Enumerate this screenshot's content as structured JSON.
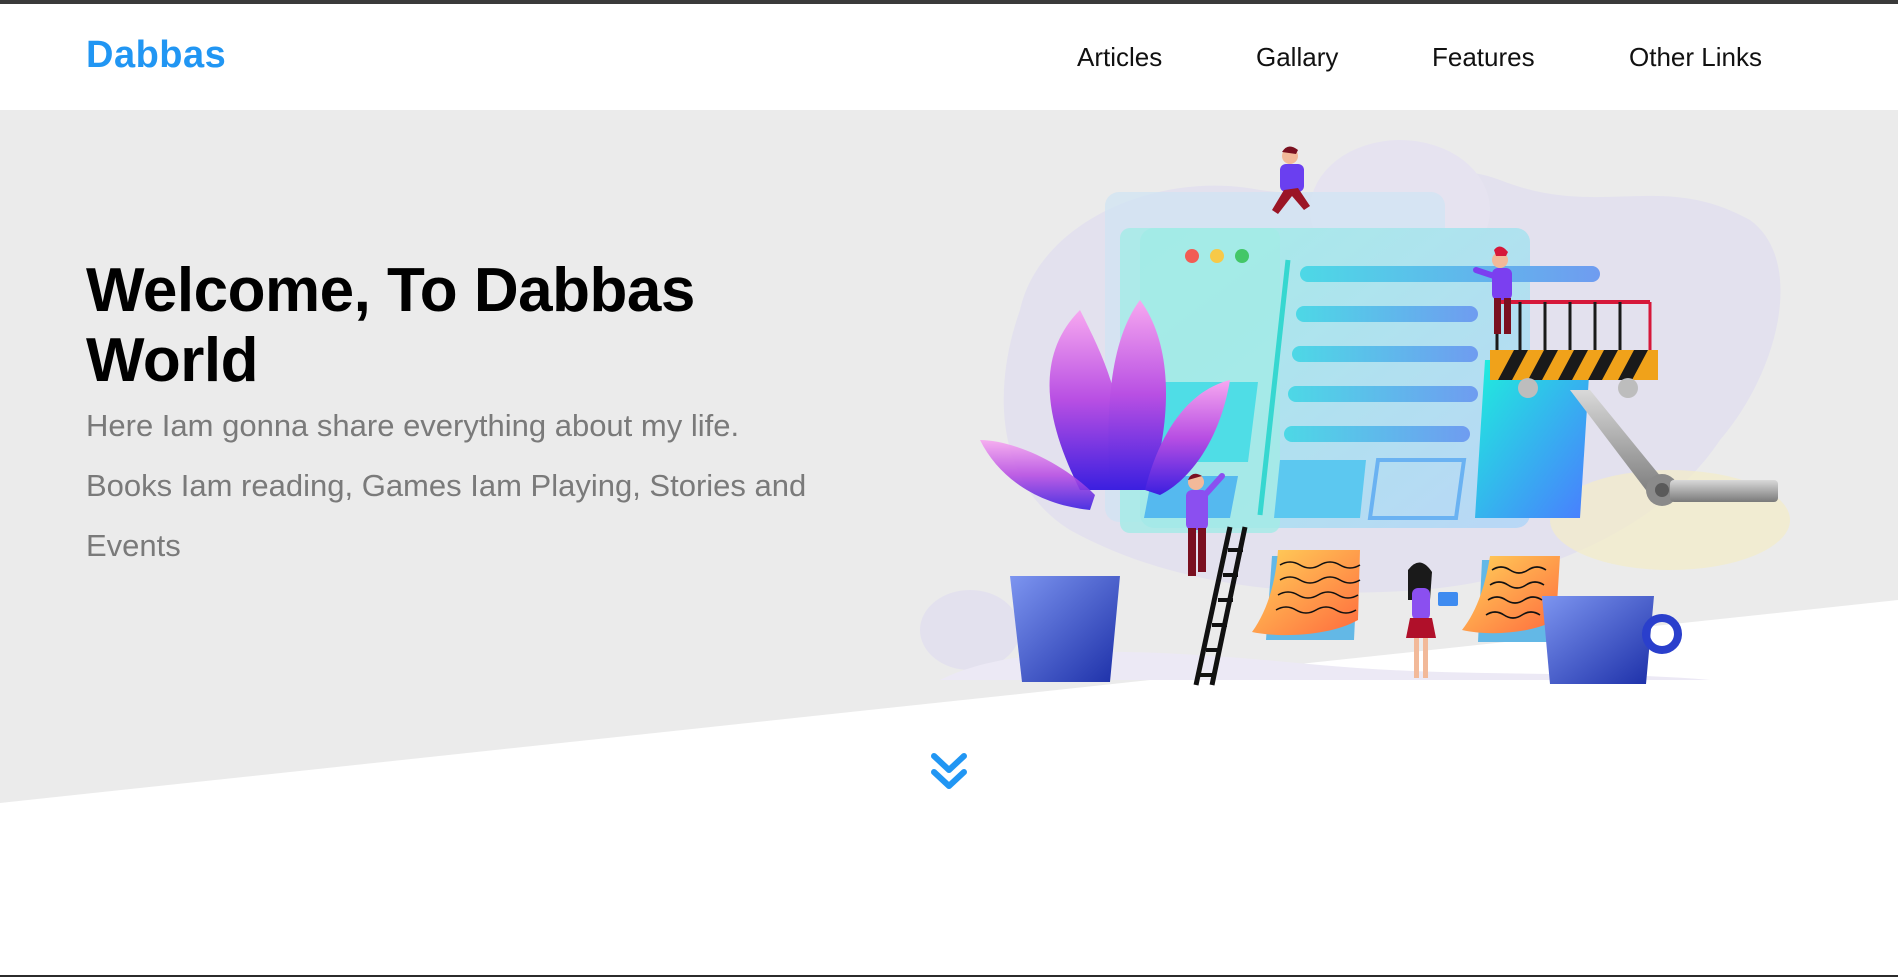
{
  "header": {
    "brand": "Dabbas",
    "nav": [
      {
        "label": "Articles"
      },
      {
        "label": "Gallary"
      },
      {
        "label": "Features"
      },
      {
        "label": "Other Links"
      }
    ]
  },
  "hero": {
    "title": "Welcome, To Dabbas World",
    "description": "Here Iam gonna share everything about my life. Books Iam reading, Games Iam Playing, Stories and Events",
    "illustration": "team-building-website-illustration",
    "scroll_icon": "double-chevron-down-icon"
  },
  "colors": {
    "brand": "#2196f3",
    "hero_background": "#ebebeb",
    "text": "#000000",
    "muted_text": "#7a7a7a"
  }
}
